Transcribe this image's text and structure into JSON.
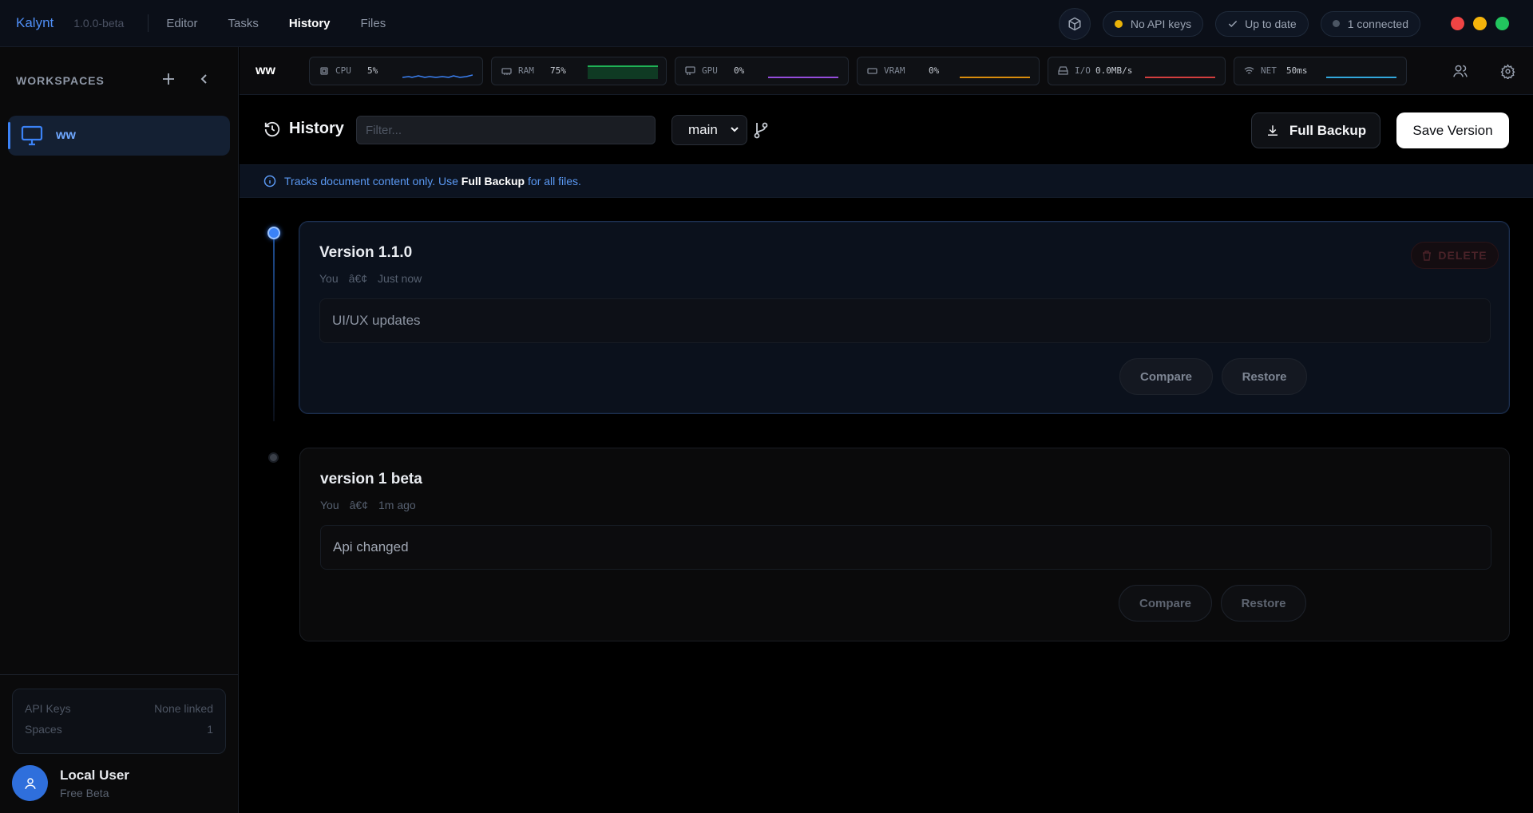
{
  "app": {
    "brand": "Kalynt",
    "version": "1.0.0-beta",
    "nav": [
      "Editor",
      "Tasks",
      "History",
      "Files"
    ],
    "active_nav": "History"
  },
  "status": {
    "api_keys": "No API keys",
    "update": "Up to date",
    "connections": "1 connected"
  },
  "sidebar": {
    "title": "WORKSPACES",
    "items": [
      {
        "label": "ww"
      }
    ],
    "stats": [
      {
        "label": "API Keys",
        "value": "None linked"
      },
      {
        "label": "Spaces",
        "value": "1"
      }
    ],
    "user": {
      "name": "Local User",
      "plan": "Free Beta"
    }
  },
  "monitor": {
    "workspace": "ww",
    "meters": [
      {
        "label": "CPU",
        "value": "5%",
        "color": "#3b82f6"
      },
      {
        "label": "RAM",
        "value": "75%",
        "color": "#22c55e"
      },
      {
        "label": "GPU",
        "value": "0%",
        "color": "#a855f7"
      },
      {
        "label": "VRAM",
        "value": "0%",
        "color": "#f59e0b"
      },
      {
        "label": "I/O",
        "value": "0.0MB/s",
        "color": "#ef4444"
      },
      {
        "label": "NET",
        "value": "50ms",
        "color": "#38bdf8"
      }
    ]
  },
  "history": {
    "title": "History",
    "filter_placeholder": "Filter...",
    "branch": "main",
    "full_backup_label": "Full Backup",
    "save_version_label": "Save Version",
    "banner_prefix": "Tracks document content only. Use ",
    "banner_bold": "Full Backup",
    "banner_suffix": " for all files.",
    "versions": [
      {
        "title": "Version 1.1.0",
        "author": "You",
        "separator": "â€¢",
        "time": "Just now",
        "description": "UI/UX updates",
        "delete_label": "DELETE",
        "compare_label": "Compare",
        "restore_label": "Restore"
      },
      {
        "title": "version 1 beta",
        "author": "You",
        "separator": "â€¢",
        "time": "1m ago",
        "description": "Api changed",
        "compare_label": "Compare",
        "restore_label": "Restore"
      }
    ]
  },
  "colors": {
    "accent": "#3b82f6",
    "close": "#ef4444",
    "minimize": "#f5b40b",
    "maximize": "#22c55e",
    "warning_dot": "#eab308"
  }
}
